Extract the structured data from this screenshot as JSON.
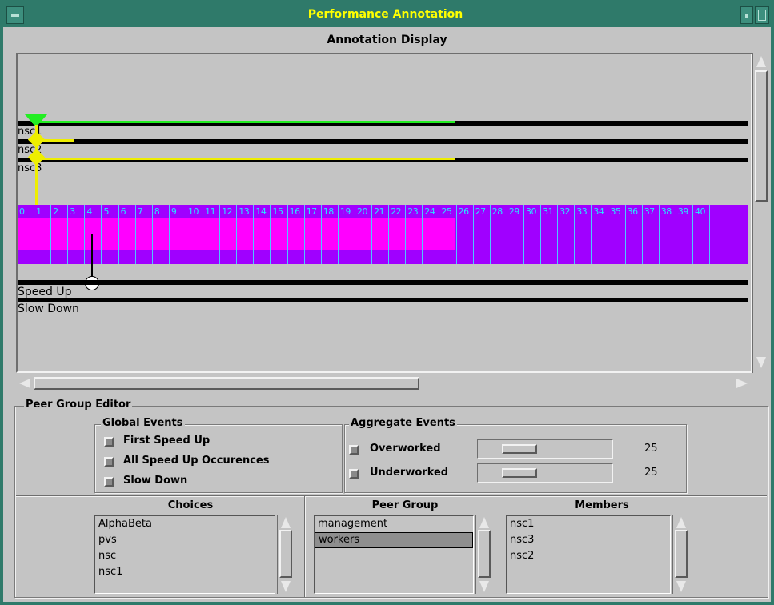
{
  "window": {
    "title": "Performance Annotation",
    "title_color": "#ffff00",
    "titlebar_color": "#2f7a6a"
  },
  "display": {
    "title": "Annotation Display",
    "trace_labels": [
      "nsc1",
      "nsc2",
      "nsc3"
    ],
    "trace_colors": [
      "#22ee22",
      "#eeee00",
      "#eeee00"
    ],
    "timeline_labels": [
      "0",
      "1",
      "2",
      "3",
      "4",
      "5",
      "6",
      "7",
      "8",
      "9",
      "10",
      "11",
      "12",
      "13",
      "14",
      "15",
      "16",
      "17",
      "18",
      "19",
      "20",
      "21",
      "22",
      "23",
      "24",
      "25",
      "26",
      "27",
      "28",
      "29",
      "30",
      "31",
      "32",
      "33",
      "34",
      "35",
      "36",
      "37",
      "38",
      "39",
      "40"
    ],
    "timeline_colors": {
      "magenta": "#ff00ff",
      "purple": "#a000ff",
      "tick": "#4cc8ff"
    },
    "event_labels": [
      "Speed Up",
      "Slow Down"
    ]
  },
  "editor": {
    "title": "Peer Group Editor",
    "global_events": {
      "title": "Global Events",
      "items": [
        "First Speed Up",
        "All Speed Up Occurences",
        "Slow Down"
      ]
    },
    "aggregate_events": {
      "title": "Aggregate Events",
      "items": [
        {
          "label": "Overworked",
          "value": "25"
        },
        {
          "label": "Underworked",
          "value": "25"
        }
      ]
    },
    "choices": {
      "title": "Choices",
      "items": [
        "AlphaBeta",
        "pvs",
        "nsc",
        "nsc1"
      ]
    },
    "peer_group": {
      "title": "Peer Group",
      "items": [
        "management",
        "workers"
      ],
      "selected": "workers"
    },
    "members": {
      "title": "Members",
      "items": [
        "nsc1",
        "nsc3",
        "nsc2"
      ]
    }
  }
}
